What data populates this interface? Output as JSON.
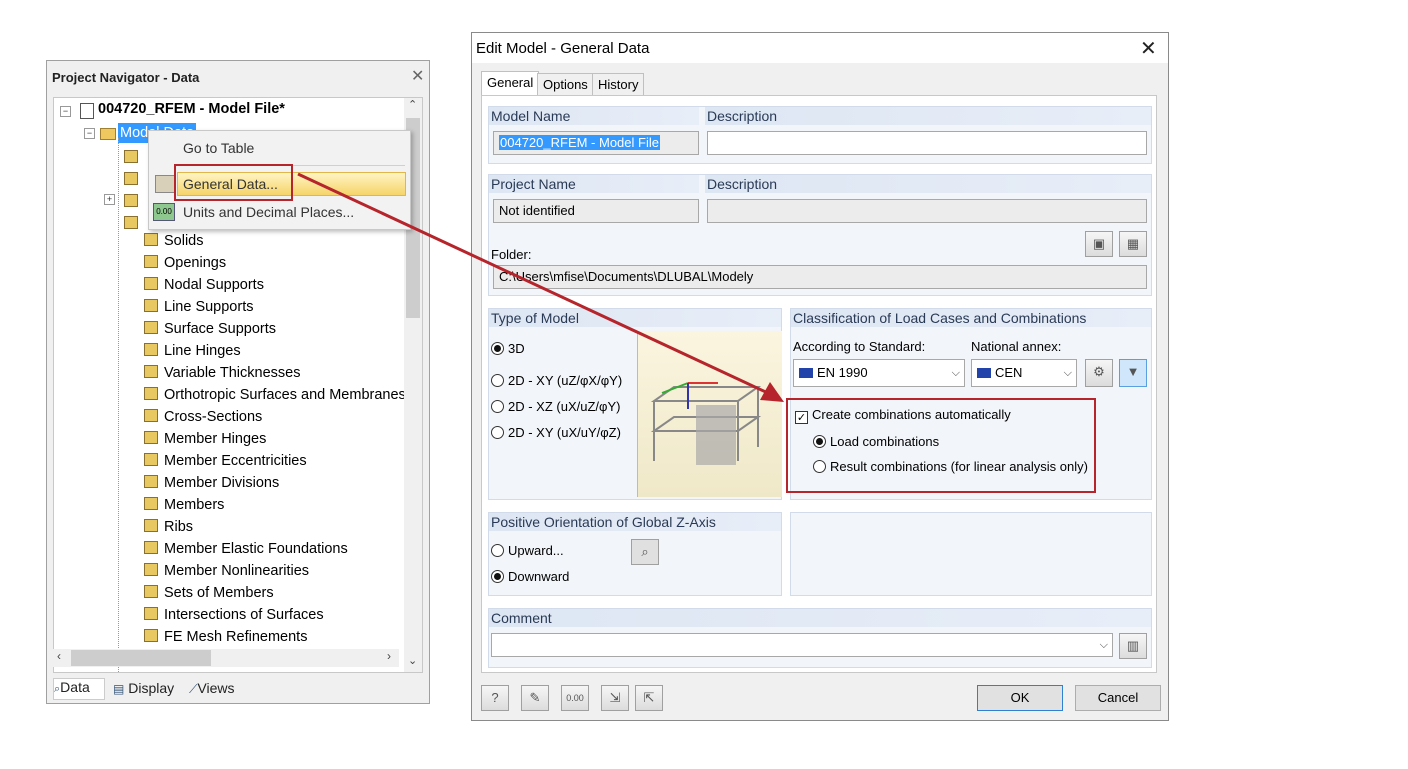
{
  "navigator": {
    "title": "Project Navigator - Data",
    "root_label": "004720_RFEM - Model File*",
    "model_data_label": "Model Data",
    "items": [
      "Solids",
      "Openings",
      "Nodal Supports",
      "Line Supports",
      "Surface Supports",
      "Line Hinges",
      "Variable Thicknesses",
      "Orthotropic Surfaces and Membranes",
      "Cross-Sections",
      "Member Hinges",
      "Member Eccentricities",
      "Member Divisions",
      "Members",
      "Ribs",
      "Member Elastic Foundations",
      "Member Nonlinearities",
      "Sets of Members",
      "Intersections of Surfaces",
      "FE Mesh Refinements"
    ],
    "tabs": [
      "Data",
      "Display",
      "Views"
    ]
  },
  "context_menu": {
    "items": [
      "Go to Table",
      "General Data...",
      "Units and Decimal Places..."
    ]
  },
  "dialog": {
    "title": "Edit Model - General Data",
    "tabs": [
      "General",
      "Options",
      "History"
    ],
    "model_name_label": "Model Name",
    "model_name_value": "004720_RFEM - Model File",
    "description_label": "Description",
    "description_value": "",
    "project_name_label": "Project Name",
    "project_name_value": "Not identified",
    "project_description_label": "Description",
    "folder_label": "Folder:",
    "folder_value": "C:\\Users\\mfise\\Documents\\DLUBAL\\Modely",
    "type_of_model": {
      "title": "Type of Model",
      "options": [
        "3D",
        "2D - XY (uZ/φX/φY)",
        "2D - XZ (uX/uZ/φY)",
        "2D - XY (uX/uY/φZ)"
      ],
      "selected": 0
    },
    "classification": {
      "title": "Classification of Load Cases and Combinations",
      "standard_label": "According to Standard:",
      "standard_value": "EN 1990",
      "annex_label": "National annex:",
      "annex_value": "CEN",
      "create_label": "Create combinations automatically",
      "create_checked": true,
      "load_combinations_label": "Load combinations",
      "result_combinations_label": "Result combinations (for linear analysis only)",
      "selected": "load"
    },
    "orientation": {
      "title": "Positive Orientation of Global Z-Axis",
      "upward_label": "Upward...",
      "downward_label": "Downward",
      "selected": "downward"
    },
    "comment_label": "Comment",
    "comment_value": "",
    "ok_label": "OK",
    "cancel_label": "Cancel"
  },
  "colors": {
    "highlight_red": "#b5252b",
    "selection_blue": "#3399ff",
    "group_header": "#dde6f3"
  }
}
